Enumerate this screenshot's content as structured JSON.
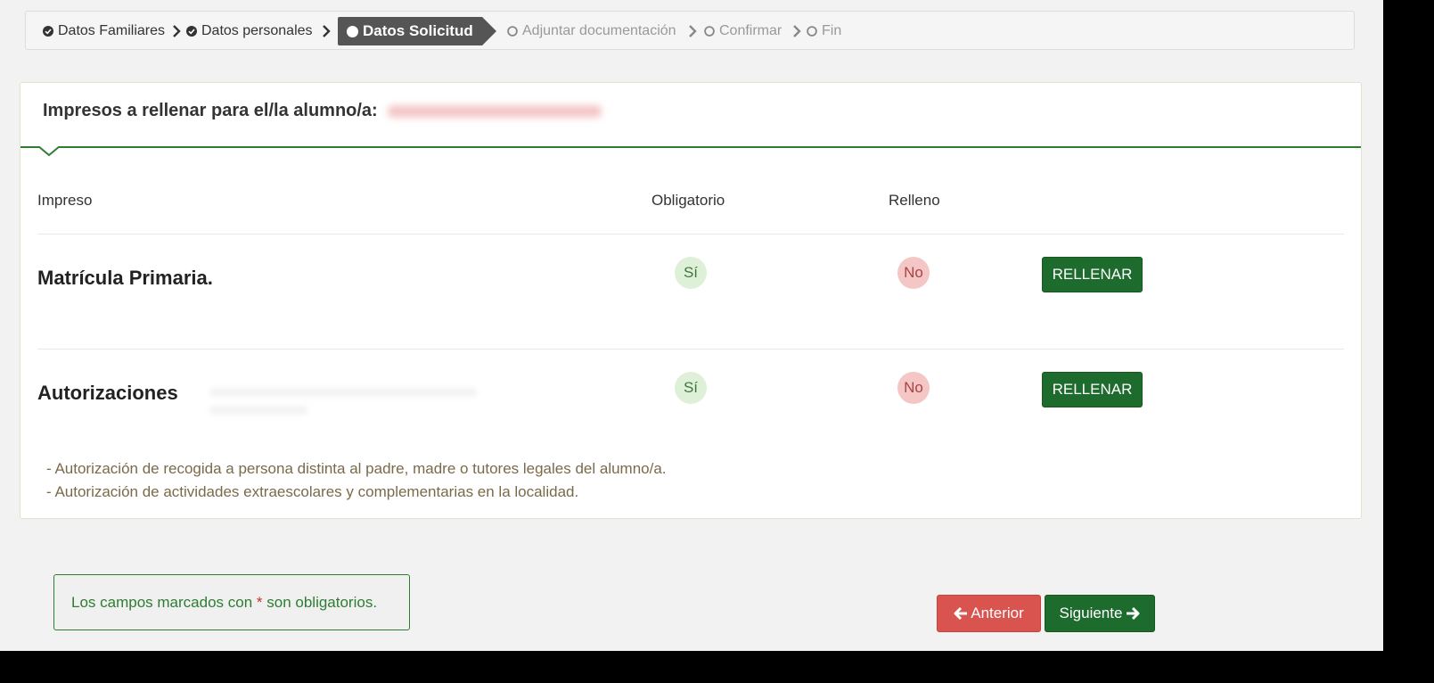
{
  "steps": [
    {
      "label": "Datos Familiares",
      "state": "done",
      "icon": "check-circle-icon"
    },
    {
      "label": "Datos personales",
      "state": "done",
      "icon": "check-circle-icon"
    },
    {
      "label": "Datos Solicitud",
      "state": "active",
      "icon": "circle-icon"
    },
    {
      "label": "Adjuntar documentación",
      "state": "pending",
      "icon": "circle-outline-icon"
    },
    {
      "label": "Confirmar",
      "state": "pending",
      "icon": "circle-outline-icon"
    },
    {
      "label": "Fin",
      "state": "pending",
      "icon": "circle-outline-icon"
    }
  ],
  "panel": {
    "title": "Impresos a rellenar para el/la alumno/a:",
    "columns": {
      "impreso": "Impreso",
      "obligatorio": "Obligatorio",
      "relleno": "Relleno"
    },
    "rows": [
      {
        "name": "Matrícula Primaria.",
        "obligatorio": "Sí",
        "relleno": "No",
        "action": "RELLENAR"
      },
      {
        "name": "Autorizaciones",
        "obligatorio": "Sí",
        "relleno": "No",
        "action": "RELLENAR"
      }
    ],
    "notes": [
      "- Autorización de recogida a persona distinta al padre, madre o tutores legales del alumno/a.",
      "- Autorización de actividades extraescolares y complementarias en la localidad."
    ]
  },
  "footer": {
    "info_before": "Los campos marcados con",
    "info_star": "*",
    "info_after": "son obligatorios.",
    "prev_label": "Anterior",
    "next_label": "Siguiente"
  },
  "colors": {
    "primary_green": "#1e6b2e",
    "danger_red": "#d9534f",
    "step_active_bg": "#555555"
  }
}
